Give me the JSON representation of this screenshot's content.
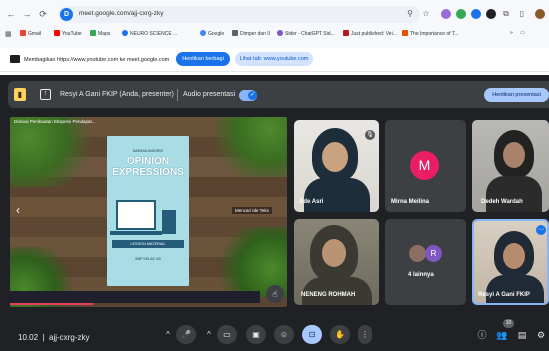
{
  "browser": {
    "url": "meet.google.com/ajj-cxrg-zky",
    "site_badge": "D",
    "bookmarks": [
      {
        "label": "Gmail",
        "color": "#ea4335"
      },
      {
        "label": "YouTube",
        "color": "#ff0000"
      },
      {
        "label": "Maps",
        "color": "#34a853"
      },
      {
        "label": "NEURO SCIENCE ...",
        "color": "#1a73e8"
      },
      {
        "label": "Google",
        "color": "#4285f4"
      },
      {
        "label": "Dimper dan II",
        "color": "#5f6368"
      },
      {
        "label": "Sider - ChatGPT Sid...",
        "color": "#7e57c2"
      },
      {
        "label": "Just published: Vei...",
        "color": "#b71c1c"
      },
      {
        "label": "The Importance of T...",
        "color": "#e65100"
      }
    ]
  },
  "share_bar": {
    "message": "Membagikan https://www.youtube.com ke meet.google.com",
    "stop_sharing": "Hentikan berbagi",
    "view_tab": "Lihat tab: www.youtube.com"
  },
  "presentation_bar": {
    "presenter": "Resyi A Gani FKIP (Anda, presenter)",
    "audio_label": "Audio presentasi",
    "stop_presenting": "Hentikan presentasi"
  },
  "slide": {
    "caption": "Diskusi Pembuatan Ekspresi Pendapat...",
    "small_top": "BAHASA INGGRIS",
    "title_line1": "OPINION",
    "title_line2": "EXPRESSIONS",
    "subtitle": "LESSON MATERIAL",
    "footer": "SMP KELAS VIII",
    "tooltip": "Mencari Ide Teks",
    "progress_percent": 33
  },
  "participants": [
    {
      "name": "Ade Asri",
      "type": "video"
    },
    {
      "name": "Mirna Meilina",
      "type": "avatar",
      "initial": "M",
      "color": "#e91e63"
    },
    {
      "name": "Dedeh Wardah",
      "type": "video"
    },
    {
      "name": "NENENG ROHMAH",
      "type": "video"
    },
    {
      "name": "4 lainnya",
      "type": "group",
      "initial": "R"
    },
    {
      "name": "Resyi A Gani FKIP",
      "type": "video"
    }
  ],
  "meeting": {
    "time": "10.02",
    "code": "ajj-cxrg-zky",
    "people_count": "10"
  }
}
